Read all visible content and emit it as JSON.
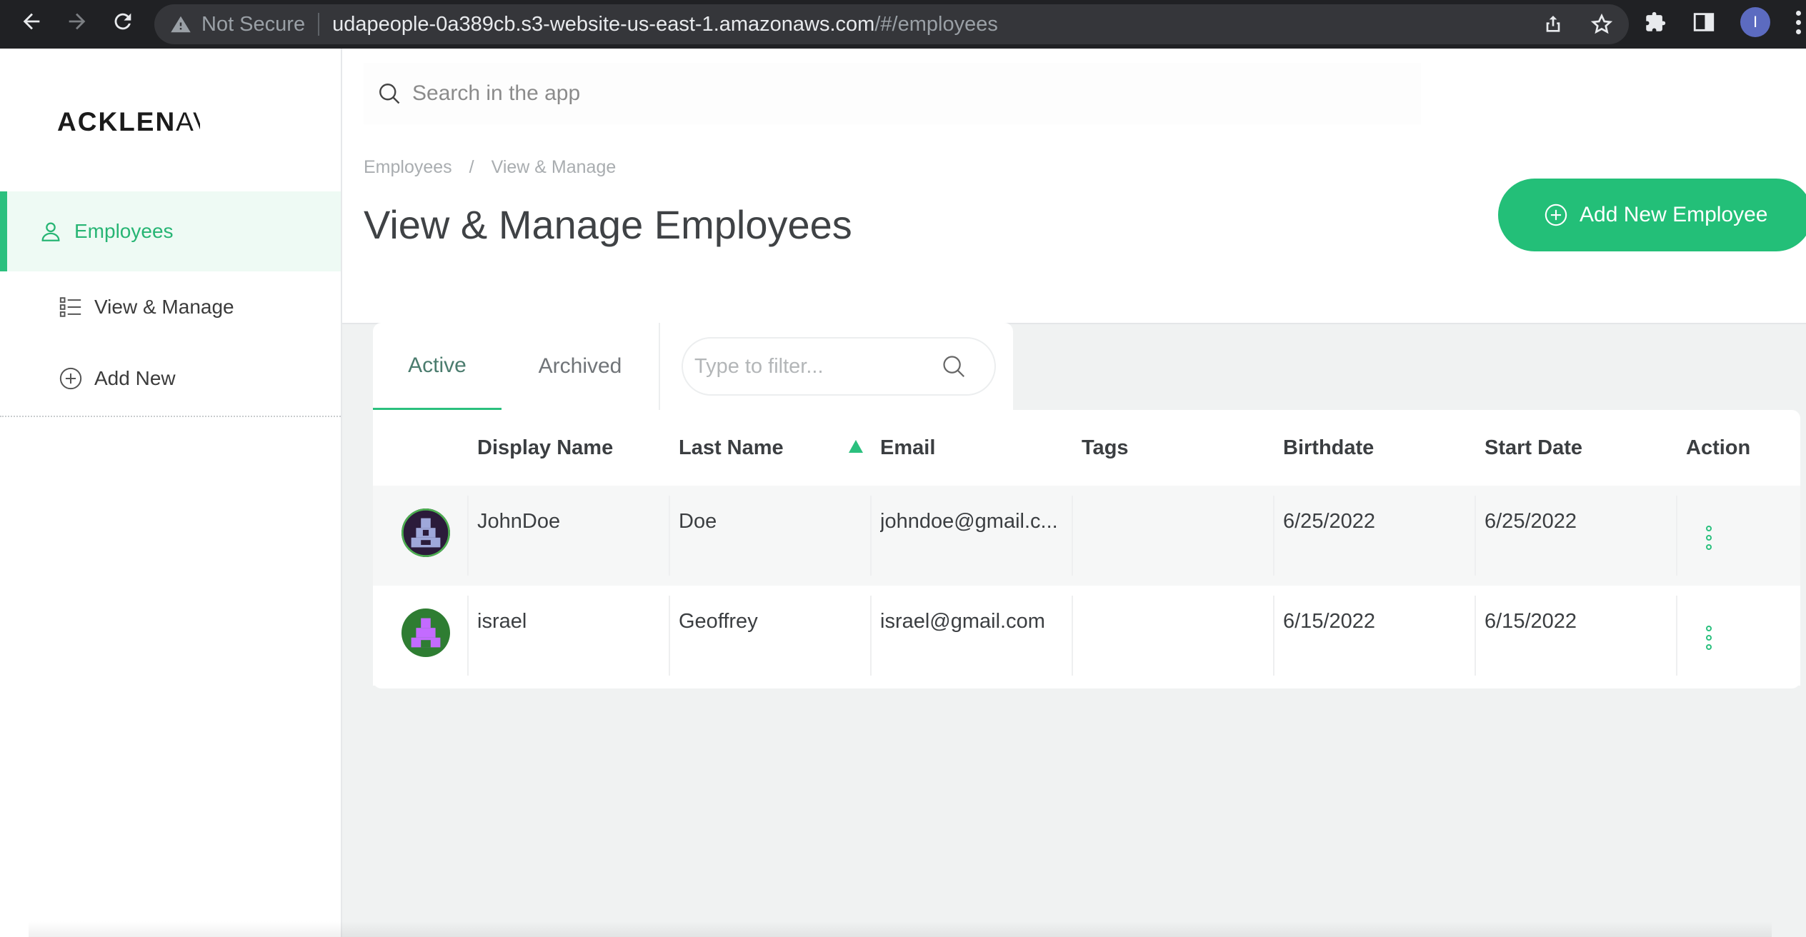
{
  "browser": {
    "security_label": "Not Secure",
    "url_host": "udapeople-0a389cb.s3-website-us-east-1.amazonaws.com",
    "url_path": "/#/employees",
    "profile_initial": "I"
  },
  "sidebar": {
    "logo_main": "ACKLEN",
    "logo_tail": "AV",
    "items": [
      {
        "label": "Employees",
        "icon": "user-icon",
        "active": true
      },
      {
        "label": "View & Manage",
        "icon": "list-icon",
        "active": false
      },
      {
        "label": "Add New",
        "icon": "plus-circle-icon",
        "active": false
      }
    ]
  },
  "search": {
    "placeholder": "Search in the app"
  },
  "breadcrumb": [
    "Employees",
    "/",
    "View & Manage"
  ],
  "page_title": "View & Manage Employees",
  "add_button_label": "Add New Employee",
  "tabs": [
    {
      "label": "Active",
      "selected": true
    },
    {
      "label": "Archived",
      "selected": false
    }
  ],
  "filter": {
    "placeholder": "Type to filter..."
  },
  "table": {
    "columns": [
      "Display Name",
      "Last Name",
      "Email",
      "Tags",
      "Birthdate",
      "Start Date",
      "Action"
    ],
    "sorted_column": "Email",
    "rows": [
      {
        "display_name": "JohnDoe",
        "last_name": "Doe",
        "email": "johndoe@gmail.c...",
        "tags": "",
        "birthdate": "6/25/2022",
        "start_date": "6/25/2022",
        "avatar_color": "#2b1b3a",
        "avatar_accent": "#9fa8da"
      },
      {
        "display_name": "israel",
        "last_name": "Geoffrey",
        "email": "israel@gmail.com",
        "tags": "",
        "birthdate": "6/15/2022",
        "start_date": "6/15/2022",
        "avatar_color": "#2e7d32",
        "avatar_accent": "#c36bff"
      }
    ]
  },
  "colors": {
    "accent": "#23bf78",
    "sidebar_active_bg": "#eefaf4",
    "chrome_bg": "#202124"
  }
}
